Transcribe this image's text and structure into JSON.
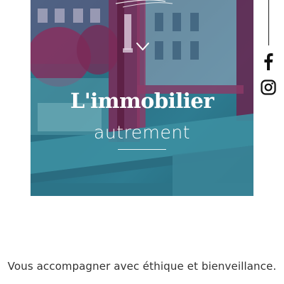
{
  "hero": {
    "title": "L'immobilier",
    "subtitle": "autrement",
    "image": "window-photo-duotone"
  },
  "social": {
    "items": [
      {
        "name": "facebook",
        "icon": "facebook-icon"
      },
      {
        "name": "instagram",
        "icon": "instagram-icon"
      }
    ]
  },
  "tagline": "Vous accompagner avec éthique et bienveillance.",
  "colors": {
    "duotone_teal": "#2f7f93",
    "duotone_magenta": "#8a2d5c",
    "text": "#333333",
    "icon": "#111111"
  }
}
